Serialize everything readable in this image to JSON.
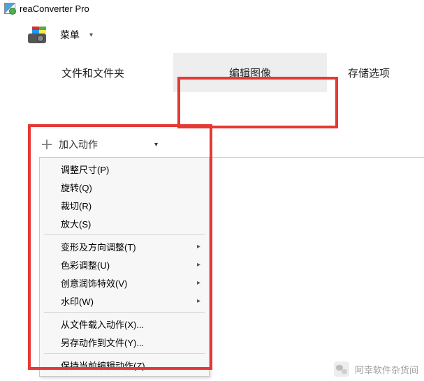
{
  "app": {
    "title": "reaConverter Pro"
  },
  "menu": {
    "label": "菜单"
  },
  "tabs": {
    "files": "文件和文件夹",
    "edit": "编辑图像",
    "save": "存储选项"
  },
  "addAction": {
    "label": "加入动作"
  },
  "dropdown": {
    "group1": [
      {
        "label": "调整尺寸(P)"
      },
      {
        "label": "旋转(Q)"
      },
      {
        "label": "裁切(R)"
      },
      {
        "label": "放大(S)"
      }
    ],
    "group2": [
      {
        "label": "变形及方向调整(T)",
        "sub": true
      },
      {
        "label": "色彩调整(U)",
        "sub": true
      },
      {
        "label": "创意润饰特效(V)",
        "sub": true
      },
      {
        "label": "水印(W)",
        "sub": true
      }
    ],
    "group3": [
      {
        "label": "从文件载入动作(X)..."
      },
      {
        "label": "另存动作到文件(Y)..."
      }
    ],
    "group4": [
      {
        "label": "保持当前编辑动作(Z)"
      }
    ]
  },
  "footer": {
    "attribution": "阿幸软件杂货间"
  }
}
